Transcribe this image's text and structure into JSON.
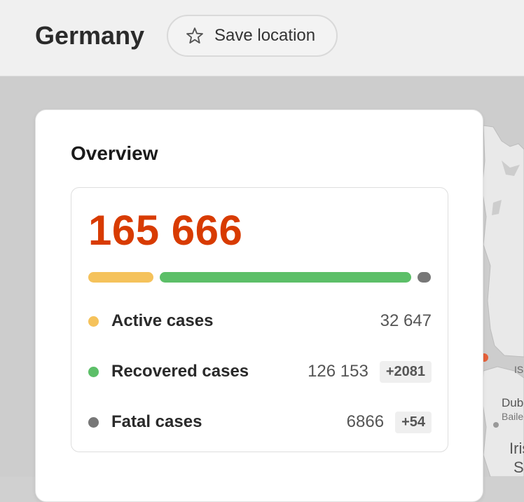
{
  "header": {
    "title": "Germany",
    "save_label": "Save location",
    "star_icon": "star-outline-icon"
  },
  "map": {
    "labels": [
      "ISI",
      "Dub",
      "Baile",
      "Iris",
      "S"
    ]
  },
  "overview": {
    "title": "Overview",
    "total": "165 666",
    "bar": {
      "active_fraction": 0.197,
      "recovered_fraction": 0.761,
      "fatal_fraction": 0.041
    },
    "rows": [
      {
        "label": "Active cases",
        "value": "32 647",
        "delta": "",
        "color": "#f5c25b"
      },
      {
        "label": "Recovered cases",
        "value": "126 153",
        "delta": "+2081",
        "color": "#5cbf68"
      },
      {
        "label": "Fatal cases",
        "value": "6866",
        "delta": "+54",
        "color": "#777777"
      }
    ]
  },
  "colors": {
    "total": "#d83b01",
    "active": "#f5c25b",
    "recovered": "#5cbf68",
    "fatal": "#777777"
  }
}
